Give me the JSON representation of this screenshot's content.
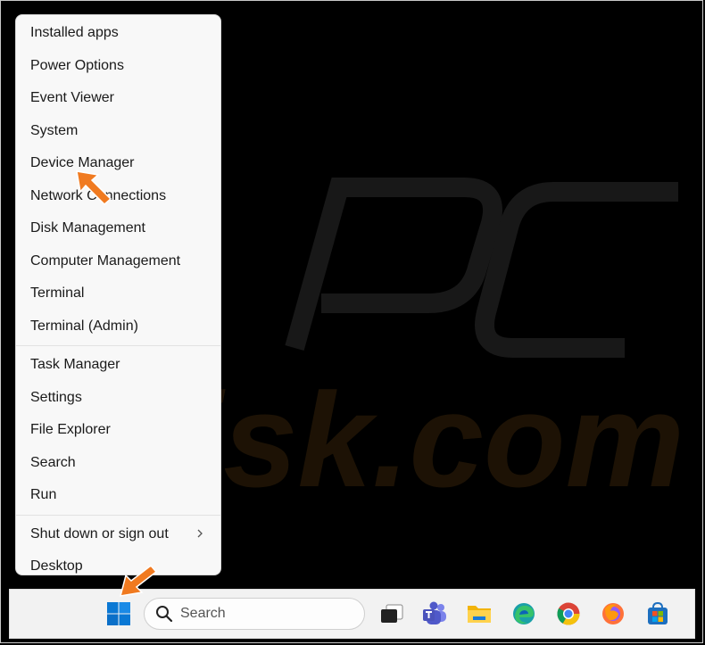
{
  "menu": {
    "group1": [
      {
        "label": "Installed apps"
      },
      {
        "label": "Power Options"
      },
      {
        "label": "Event Viewer"
      },
      {
        "label": "System"
      },
      {
        "label": "Device Manager"
      },
      {
        "label": "Network Connections"
      },
      {
        "label": "Disk Management"
      },
      {
        "label": "Computer Management"
      },
      {
        "label": "Terminal"
      },
      {
        "label": "Terminal (Admin)"
      }
    ],
    "group2": [
      {
        "label": "Task Manager"
      },
      {
        "label": "Settings"
      },
      {
        "label": "File Explorer"
      },
      {
        "label": "Search"
      },
      {
        "label": "Run"
      }
    ],
    "group3": [
      {
        "label": "Shut down or sign out",
        "has_submenu": true
      },
      {
        "label": "Desktop"
      }
    ]
  },
  "taskbar": {
    "search_placeholder": "Search",
    "icons": [
      "windows-start-icon",
      "search-icon",
      "task-view-icon",
      "teams-icon",
      "file-explorer-icon",
      "edge-icon",
      "chrome-icon",
      "firefox-icon",
      "microsoft-store-icon"
    ]
  },
  "watermark": {
    "text": "PC risk.com"
  },
  "colors": {
    "arrow": "#f07a20",
    "menu_bg": "#f8f8f8",
    "desktop": "#000000",
    "windows_blue": "#0a78d4"
  }
}
